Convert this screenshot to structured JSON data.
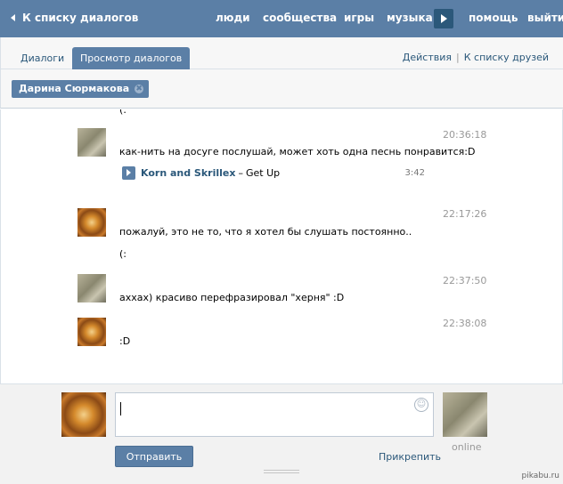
{
  "topbar": {
    "back": "К списку диалогов",
    "nav": [
      "люди",
      "сообщества",
      "игры",
      "музыка",
      "помощь",
      "выйти"
    ]
  },
  "tabs": {
    "dialogs": "Диалоги",
    "view": "Просмотр диалогов",
    "actions": "Действия",
    "sep": "|",
    "friends": "К списку друзей"
  },
  "chip": {
    "name": "Дарина Сюрмакова",
    "close": "✖"
  },
  "messages": [
    {
      "text": "(:"
    },
    {
      "time": "20:36:18",
      "text": "как-нить на досуге послушай, может хоть одна песнь понравится:D"
    },
    {
      "time": "22:17:26",
      "text": "пожалуй, это не то, что я хотел бы слушать постоянно..",
      "text2": "(:"
    },
    {
      "time": "22:37:50",
      "text": "аххах) красиво перефразировал \"херня\" :D"
    },
    {
      "time": "22:38:08",
      "text": ":D"
    }
  ],
  "audio": {
    "artist": "Korn and Skrillex",
    "dash": "–",
    "title": "Get Up",
    "duration": "3:42"
  },
  "compose": {
    "send": "Отправить",
    "attach": "Прикрепить",
    "status": "online",
    "smile": "☺"
  },
  "watermark": "pikabu.ru"
}
